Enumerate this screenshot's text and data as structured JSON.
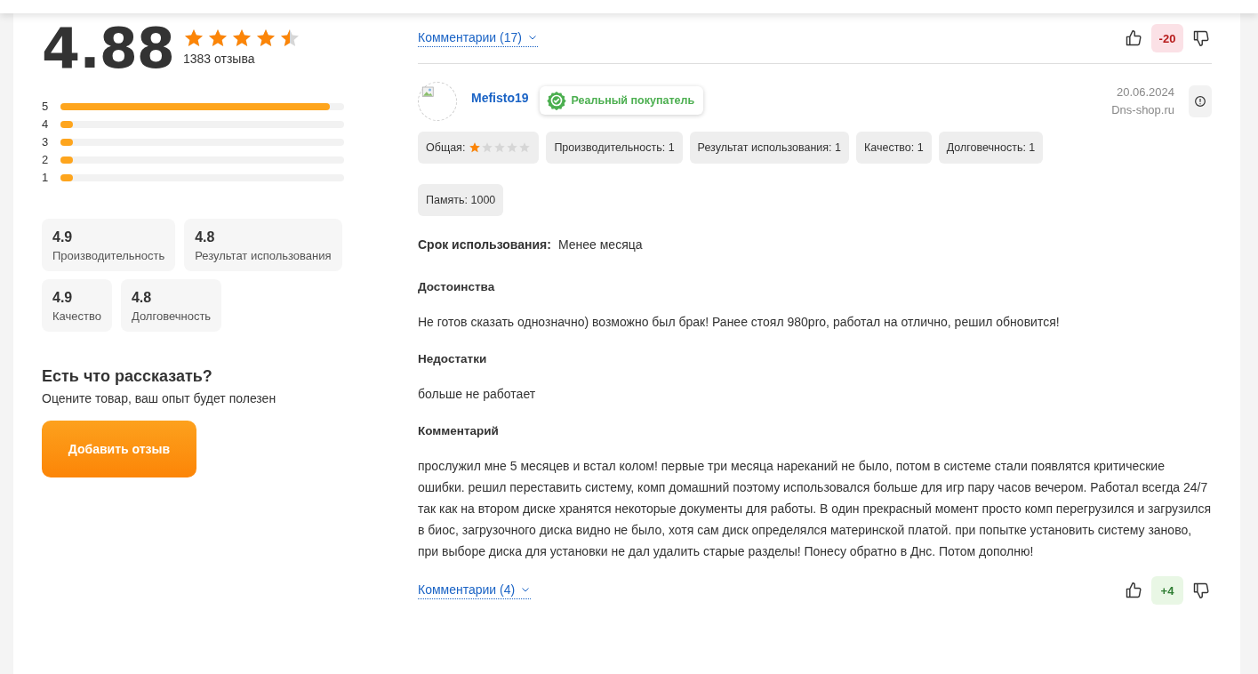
{
  "summary": {
    "score": "4.88",
    "stars": 4.5,
    "count": "1383 отзыва",
    "distribution": [
      {
        "label": "5",
        "level": 0.95
      },
      {
        "label": "4",
        "level": 0.045
      },
      {
        "label": "3",
        "level": 0.045
      },
      {
        "label": "2",
        "level": 0.045
      },
      {
        "label": "1",
        "level": 0.045
      }
    ],
    "aspects": [
      {
        "value": "4.9",
        "label": "Производительность"
      },
      {
        "value": "4.8",
        "label": "Результат использования"
      },
      {
        "value": "4.9",
        "label": "Качество"
      },
      {
        "value": "4.8",
        "label": "Долговечность"
      }
    ],
    "prompt_title": "Есть что рассказать?",
    "prompt_text": "Оцените товар, ваш опыт будет полезен",
    "add_button": "Добавить отзыв"
  },
  "prev_review_footer": {
    "comments": "Комментарии (17)",
    "votes": {
      "count": "-20",
      "kind": "negative"
    }
  },
  "review": {
    "author": "Mefisto19",
    "badge": "Реальный покупатель",
    "date": "20.06.2024",
    "source": "Dns-shop.ru",
    "overall_label": "Общая:",
    "stars": 1,
    "ratings": [
      "Производительность: 1",
      "Результат использования: 1",
      "Качество: 1",
      "Долговечность: 1",
      "Память: 1000"
    ],
    "usage_label": "Срок использования:",
    "usage_value": "Менее месяца",
    "sections": [
      {
        "title": "Достоинства",
        "text": "Не готов сказать однозначно) возможно был брак! Ранее стоял 980pro, работал на отлично, решил обновится!"
      },
      {
        "title": "Недостатки",
        "text": "больше не работает"
      },
      {
        "title": "Комментарий",
        "text": "прослужил мне 5 месяцев и встал колом! первые три месяца нареканий не было, потом в системе стали появлятся критические ошибки. решил переставить систему, комп домашний поэтому использовался больше для игр пару часов вечером. Работал всегда 24/7 так как на втором диске хранятся некоторые документы для работы. В один прекрасный момент просто комп перегрузился и загрузился в биос, загрузочного диска видно не было, хотя сам диск определялся материнской платой. при попытке установить систему заново, при выборе диска для установки не дал удалить старые разделы! Понесу обратно в Днс. Потом дополню!"
      }
    ],
    "comments": "Комментарии (4)",
    "votes": {
      "count": "+4",
      "kind": "positive"
    }
  }
}
